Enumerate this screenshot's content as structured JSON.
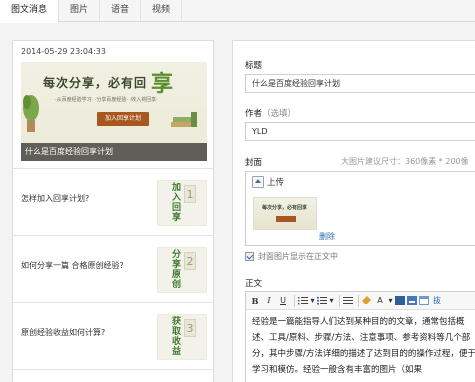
{
  "tabs": [
    {
      "label": "图文消息",
      "active": true
    },
    {
      "label": "图片",
      "active": false
    },
    {
      "label": "语音",
      "active": false
    },
    {
      "label": "视频",
      "active": false
    }
  ],
  "cover": {
    "time": "2014-05-29 23:04:33",
    "banner_title": "每次分享，必有回",
    "banner_big": "享",
    "banner_sub": "·从百度经验学习·  ·分享百度经验·  ·收入将回享·",
    "banner_button": "加入回享计划",
    "caption": "什么是百度经验回享计划"
  },
  "items": [
    {
      "question": "怎样加入回享计划?",
      "thumb_text": "加入回享",
      "thumb_num": "1"
    },
    {
      "question": "如何分享一篇 合格原创经验?",
      "thumb_text": "分享原创",
      "thumb_num": "2"
    },
    {
      "question": "原创经验收益如何计算?",
      "thumb_text": "获取收益",
      "thumb_num": "3"
    }
  ],
  "form": {
    "title_label": "标题",
    "title_value": "什么是百度经验回享计划",
    "author_label": "作者",
    "author_optional": "（选填）",
    "author_value": "YLD",
    "cover_label": "封面",
    "cover_hint": "大图片建议尺寸：360像素 * 200像",
    "upload_label": "上传",
    "mini_thumb_text": "每次分享，必有回享",
    "delete_label": "删除",
    "show_in_body_label": "封面图片显示在正文中",
    "body_label": "正文",
    "toolbar": {
      "bold": "B",
      "italic": "I",
      "underline": "U",
      "font_color": "A",
      "extra": "抜"
    },
    "body_text": "经验是一篇能指导人们达到某种目的的文章，通常包括概述、工具/原料、步骤/方法、注意事项、参考资料等几个部分，其中步骤/方法详细的描述了达到目的的操作过程，便于学习和模仿。经验一般含有丰富的图片（如果"
  }
}
